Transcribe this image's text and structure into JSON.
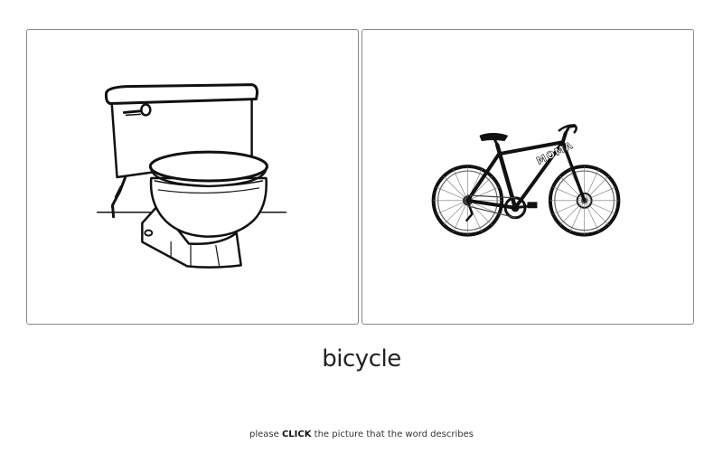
{
  "choices": [
    {
      "picture": "toilet",
      "icon": "toilet-icon"
    },
    {
      "picture": "bicycle",
      "icon": "bicycle-icon",
      "frame_text": "MOMA"
    }
  ],
  "target_word": "bicycle",
  "instruction": {
    "before": "please ",
    "emphasis": "CLICK",
    "after": " the picture that the word describes"
  },
  "colors": {
    "card_border": "#888888",
    "text": "#222222",
    "line_art": "#111111"
  }
}
